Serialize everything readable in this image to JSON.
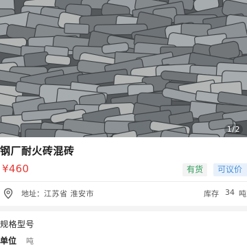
{
  "gallery": {
    "image": "pile-of-grey-refractory-bricks-photo",
    "indicator": "1/2"
  },
  "product": {
    "title": "钢厂耐火砖混砖",
    "price": "¥460",
    "stock_badge": "有货",
    "negotiable_badge": "可议价"
  },
  "address": {
    "icon": "location-pin-icon",
    "label": "地址：",
    "value": "江苏省 淮安市"
  },
  "inventory": {
    "label": "库存",
    "value": "34",
    "unit": "吨"
  },
  "specs": {
    "heading": "规格型号",
    "rows": [
      {
        "label": "单位",
        "value": "吨"
      }
    ]
  },
  "colors": {
    "price": "#e53935",
    "stock_badge_text": "#2e9c5a",
    "negotiable_badge_text": "#4a90d9",
    "negotiable_badge_bg": "#e8f1fb"
  }
}
